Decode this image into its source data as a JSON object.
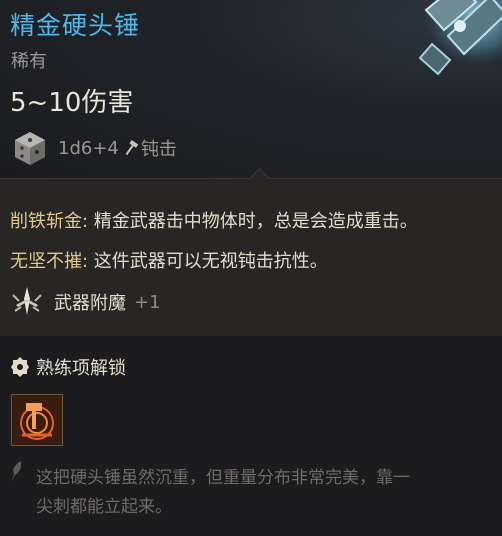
{
  "item": {
    "name": "精金硬头锤",
    "rarity": "稀有",
    "damage": "5~10伤害",
    "dice": "1d6+4",
    "damage_type": "钝击",
    "name_color": "#4fb6e8"
  },
  "passives": [
    {
      "name": "削铁斩金:",
      "desc": " 精金武器击中物体时，总是会造成重击。"
    },
    {
      "name": "无坚不摧:",
      "desc": " 这件武器可以无视钝击抗性。"
    }
  ],
  "enchant": {
    "label": "武器附魔",
    "value": "+1"
  },
  "proficiency": {
    "title": "熟练项解锁",
    "flavor": "这把硬头锤虽然沉重，但重量分布非常完美，靠一\n尖刺都能立起来。"
  },
  "icons": {
    "weapon": "mace-head-art",
    "dice": "d6-dice-icon",
    "damage_type": "hammer-icon",
    "enchant": "enchant-sword-icon",
    "unlock": "unlock-icon",
    "proficiency_slot": "smash-proficiency-icon",
    "flavor": "quill-icon"
  }
}
